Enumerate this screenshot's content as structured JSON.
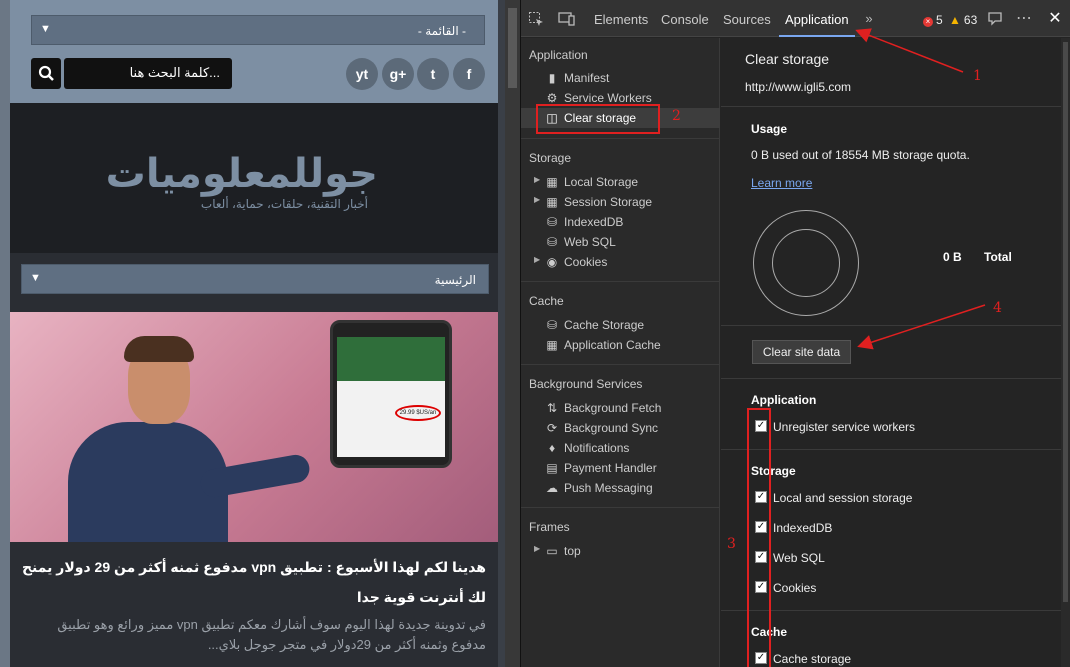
{
  "site": {
    "menu_label": "- القائمة -",
    "search_placeholder": "كلمة البحث هنا...",
    "social": [
      "f",
      "t",
      "g+",
      "yt"
    ],
    "logo_text": "جوللمعلوميات",
    "logo_sub": "أخبار التقنية، حلقات، حماية، ألعاب",
    "home_label": "الرئيسية",
    "phone_price": "29.99 $US/an",
    "post_title": "هدينا لكم لهذا الأسبوع : تطبيق vpn مدفوع ثمنه أكثر من 29 دولار يمنح لك أنترنت قوية جدا",
    "post_excerpt": "في تدوينة جديدة لهذا اليوم سوف أشارك معكم تطبيق vpn مميز ورائع وهو تطبيق مدفوع وثمنه أكثر من 29دولار في متجر جوجل بلاي..."
  },
  "devtools": {
    "tabs": [
      "Elements",
      "Console",
      "Sources",
      "Application"
    ],
    "active_tab": "Application",
    "errors": "5",
    "warnings": "63",
    "sidebar": {
      "application_head": "Application",
      "application_items": [
        "Manifest",
        "Service Workers",
        "Clear storage"
      ],
      "storage_head": "Storage",
      "storage_items": [
        "Local Storage",
        "Session Storage",
        "IndexedDB",
        "Web SQL",
        "Cookies"
      ],
      "cache_head": "Cache",
      "cache_items": [
        "Cache Storage",
        "Application Cache"
      ],
      "bg_head": "Background Services",
      "bg_items": [
        "Background Fetch",
        "Background Sync",
        "Notifications",
        "Payment Handler",
        "Push Messaging"
      ],
      "frames_head": "Frames",
      "frames_items": [
        "top"
      ]
    },
    "main": {
      "title": "Clear storage",
      "url": "http://www.igli5.com",
      "usage_head": "Usage",
      "usage_text": "0 B used out of 18554 MB storage quota.",
      "learn_more": "Learn more",
      "usage_value": "0 B",
      "usage_total": "Total",
      "clear_button": "Clear site data",
      "app_head": "Application",
      "app_checks": [
        "Unregister service workers"
      ],
      "storage_head": "Storage",
      "storage_checks": [
        "Local and session storage",
        "IndexedDB",
        "Web SQL",
        "Cookies"
      ],
      "cache_head": "Cache",
      "cache_checks": [
        "Cache storage"
      ]
    }
  },
  "annotations": [
    "1",
    "2",
    "3",
    "4"
  ],
  "colors": {
    "annotation": "#e02020",
    "accent": "#7aa7f0"
  }
}
